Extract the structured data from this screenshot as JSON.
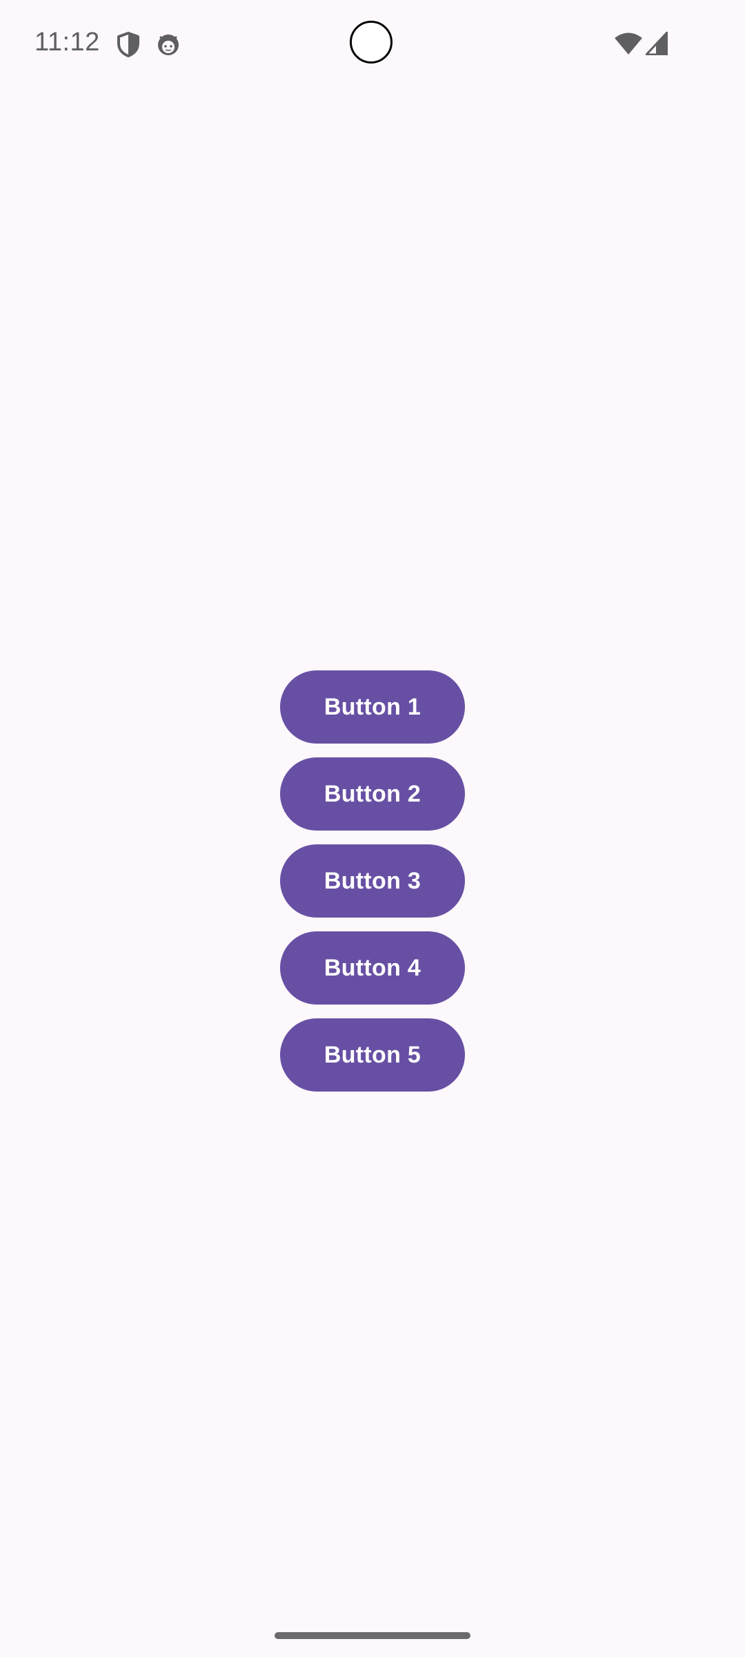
{
  "status_bar": {
    "time": "11:12",
    "icons": [
      "shield-icon",
      "android-icon",
      "wifi-icon",
      "signal-icon"
    ],
    "icon_color": "#5f5f63"
  },
  "colors": {
    "background": "#fdf8fc",
    "button_background": "#6750a4",
    "button_text": "#ffffff"
  },
  "buttons": [
    {
      "label": "Button 1"
    },
    {
      "label": "Button 2"
    },
    {
      "label": "Button 3"
    },
    {
      "label": "Button 4"
    },
    {
      "label": "Button 5"
    }
  ]
}
